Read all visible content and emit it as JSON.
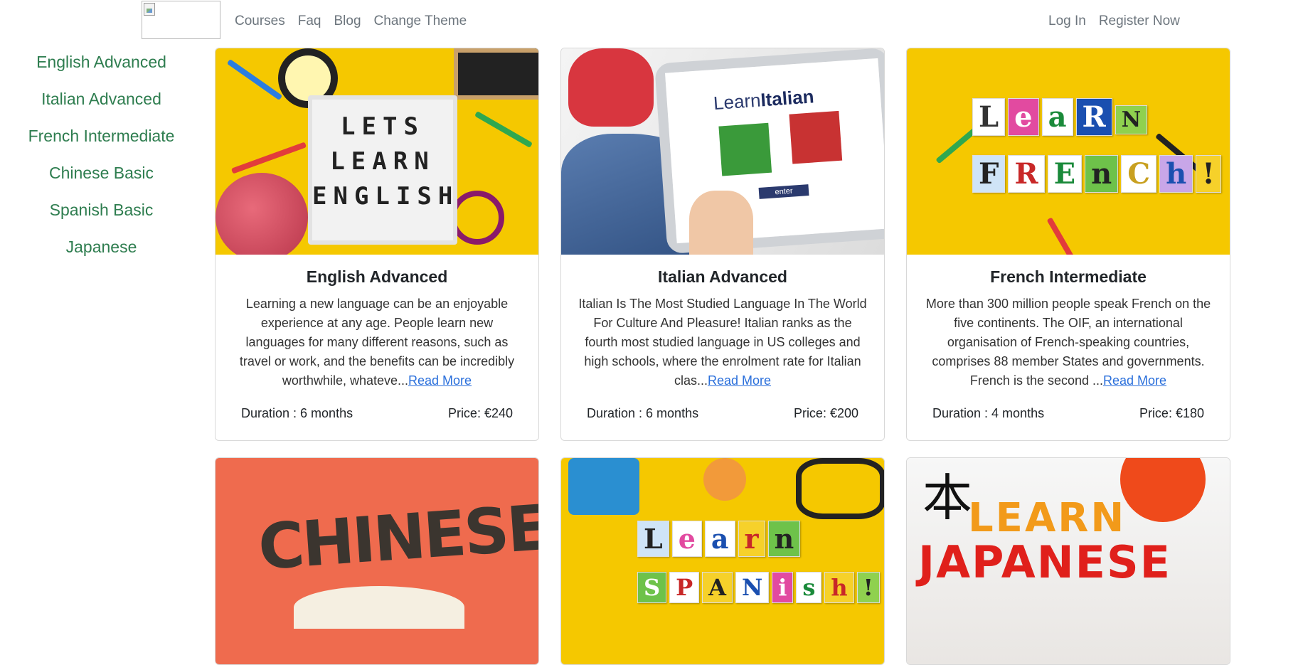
{
  "navbar": {
    "logo_alt": "",
    "links": [
      "Courses",
      "Faq",
      "Blog",
      "Change Theme"
    ],
    "login": "Log In",
    "register": "Register Now"
  },
  "sidebar": {
    "items": [
      {
        "label": "English Advanced"
      },
      {
        "label": "Italian Advanced"
      },
      {
        "label": "French Intermediate"
      },
      {
        "label": "Chinese Basic"
      },
      {
        "label": "Spanish Basic"
      },
      {
        "label": "Japanese"
      }
    ]
  },
  "cards": [
    {
      "title": "English Advanced",
      "text": "Learning a new language can be an enjoyable experience at any age. People learn new languages for many different reasons, such as travel or work, and the benefits can be incredibly worthwhile, whateve...",
      "read_more": "Read More",
      "duration": "Duration : 6 months",
      "price": "Price: €240",
      "image_text": [
        "LETS",
        "LEARN",
        "ENGLISH"
      ]
    },
    {
      "title": "Italian Advanced",
      "text": "Italian Is The Most Studied Language In The World For Culture And Pleasure! Italian ranks as the fourth most studied language in US colleges and high schools, where the enrolment rate for Italian clas...",
      "read_more": "Read More",
      "duration": "Duration : 6 months",
      "price": "Price: €200",
      "image_text": {
        "learn": "Learn",
        "italian": "Italian",
        "enter": "enter"
      }
    },
    {
      "title": "French Intermediate",
      "text": "More than 300 million people speak French on the five continents. The OIF, an international organisation of French-speaking countries, comprises 88 member States and governments. French is the second ...",
      "read_more": "Read More",
      "duration": "Duration : 4 months",
      "price": "Price: €180",
      "image_text": {
        "line1": [
          "L",
          "e",
          "a",
          "R",
          "N"
        ],
        "line2": [
          "F",
          "R",
          "E",
          "n",
          "C",
          "h",
          "!"
        ]
      }
    },
    {
      "image_text": "CHINESE"
    },
    {
      "image_text": {
        "line1": [
          "L",
          "e",
          "a",
          "r",
          "n"
        ],
        "line2": [
          "S",
          "P",
          "A",
          "N",
          "i",
          "s",
          "h",
          "!"
        ]
      }
    },
    {
      "image_text": {
        "kanji": "本",
        "learn": "LEARN",
        "japanese": "JAPANESE"
      }
    }
  ]
}
